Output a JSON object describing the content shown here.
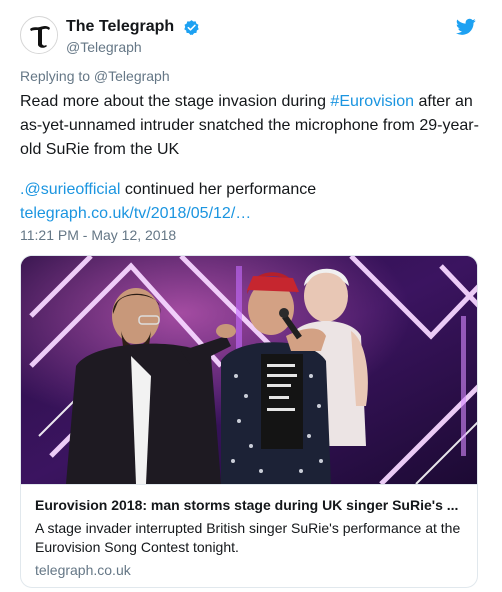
{
  "tweet": {
    "display_name": "The Telegraph",
    "handle": "@Telegraph",
    "avatar_letter": "T",
    "icons": {
      "avatar": "telegraph-logo-icon",
      "verified": "verified-badge-icon",
      "bird": "twitter-bird-icon"
    },
    "colors": {
      "accent": "#1b95e0",
      "secondary_text": "#657786",
      "bird": "#1da1f2"
    },
    "replying_to": "Replying to @Telegraph",
    "text": {
      "line1_pre": "Read more about the stage invasion during ",
      "hashtag": "#Eurovision",
      "line1_post": " after an as-yet-unnamed intruder snatched the microphone from 29-year-old SuRie from the UK",
      "mention": ".@surieofficial",
      "line2_post": " continued her performance",
      "url": "telegraph.co.uk/tv/2018/05/12/…"
    },
    "timestamp": "11:21 PM - May 12, 2018",
    "card": {
      "title": "Eurovision 2018: man storms stage during UK singer SuRie's ...",
      "description": "A stage invader interrupted British singer SuRie's performance at the Eurovision Song Contest tonight.",
      "domain": "telegraph.co.uk",
      "image_alt": "stage-invasion-photo"
    }
  }
}
